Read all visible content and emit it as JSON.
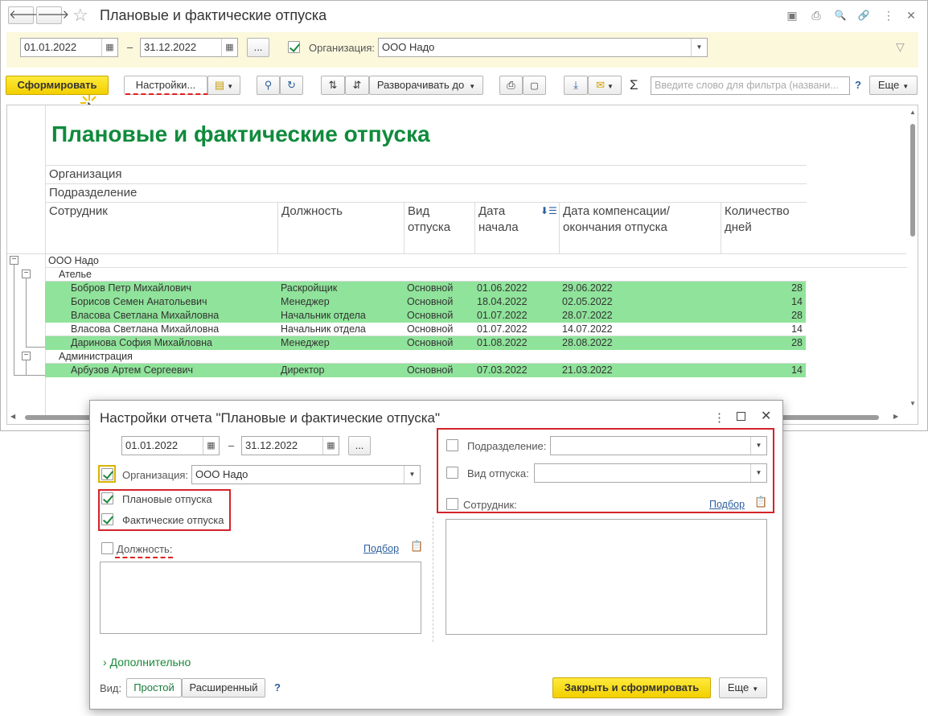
{
  "window": {
    "title": "Плановые и фактические отпуска"
  },
  "nav": {
    "back": "🡐",
    "forward": "🡒",
    "star": "☆"
  },
  "title_icons": [
    "save-icon",
    "print-icon",
    "preview-icon",
    "link-icon",
    "more-icon",
    "close-icon"
  ],
  "title_icon_glyphs": {
    "save": "▣",
    "print": "⎙",
    "preview": "🔍",
    "link": "🔗",
    "more": "⋮",
    "close": "✕"
  },
  "filters": {
    "date_from": "01.01.2022",
    "date_to": "31.12.2022",
    "dash": "–",
    "dots": "...",
    "org_checked": true,
    "org_label": "Организация:",
    "org_value": "ООО Надо",
    "funnel": "⚲"
  },
  "toolbar": {
    "generate": "Сформировать",
    "settings": "Настройки...",
    "expand": "Разворачивать до",
    "sigma": "Σ",
    "search_placeholder": "Введите слово для фильтра (названи...",
    "help": "?",
    "more": "Еще"
  },
  "report": {
    "title": "Плановые и фактические отпуска",
    "group_headers": [
      "Организация",
      "Подразделение"
    ],
    "columns": {
      "employee": "Сотрудник",
      "position": "Должность",
      "type": "Вид отпуска",
      "start": "Дата начала",
      "end": "Дата компенсации/окончания отпуска",
      "days": "Количество дней"
    },
    "org": "ООО Надо",
    "groups": [
      {
        "name": "Ателье",
        "rows": [
          {
            "employee": "Бобров Петр Михайлович",
            "position": "Раскройщик",
            "type": "Основной",
            "start": "01.06.2022",
            "end": "29.06.2022",
            "days": "28",
            "green": true
          },
          {
            "employee": "Борисов Семен Анатольевич",
            "position": "Менеджер",
            "type": "Основной",
            "start": "18.04.2022",
            "end": "02.05.2022",
            "days": "14",
            "green": true
          },
          {
            "employee": "Власова Светлана Михайловна",
            "position": "Начальник отдела",
            "type": "Основной",
            "start": "01.07.2022",
            "end": "28.07.2022",
            "days": "28",
            "green": true
          },
          {
            "employee": "Власова Светлана Михайловна",
            "position": "Начальник отдела",
            "type": "Основной",
            "start": "01.07.2022",
            "end": "14.07.2022",
            "days": "14",
            "green": false
          },
          {
            "employee": "Даринова София Михайловна",
            "position": "Менеджер",
            "type": "Основной",
            "start": "01.08.2022",
            "end": "28.08.2022",
            "days": "28",
            "green": true
          }
        ]
      },
      {
        "name": "Администрация",
        "rows": [
          {
            "employee": "Арбузов Артем Сергеевич",
            "position": "Директор",
            "type": "Основной",
            "start": "07.03.2022",
            "end": "21.03.2022",
            "days": "14",
            "green": true
          }
        ]
      }
    ]
  },
  "dialog": {
    "title": "Настройки отчета \"Плановые и фактические отпуска\"",
    "date_from": "01.01.2022",
    "date_to": "31.12.2022",
    "org_label": "Организация:",
    "org_value": "ООО Надо",
    "planned": "Плановые отпуска",
    "actual": "Фактические отпуска",
    "position_label": "Должность:",
    "pick": "Подбор",
    "division_label": "Подразделение:",
    "vac_type_label": "Вид отпуска:",
    "employee_label": "Сотрудник:",
    "additional": "Дополнительно",
    "view_label": "Вид:",
    "view_simple": "Простой",
    "view_extended": "Расширенный",
    "help": "?",
    "close_generate": "Закрыть и сформировать",
    "more": "Еще"
  }
}
